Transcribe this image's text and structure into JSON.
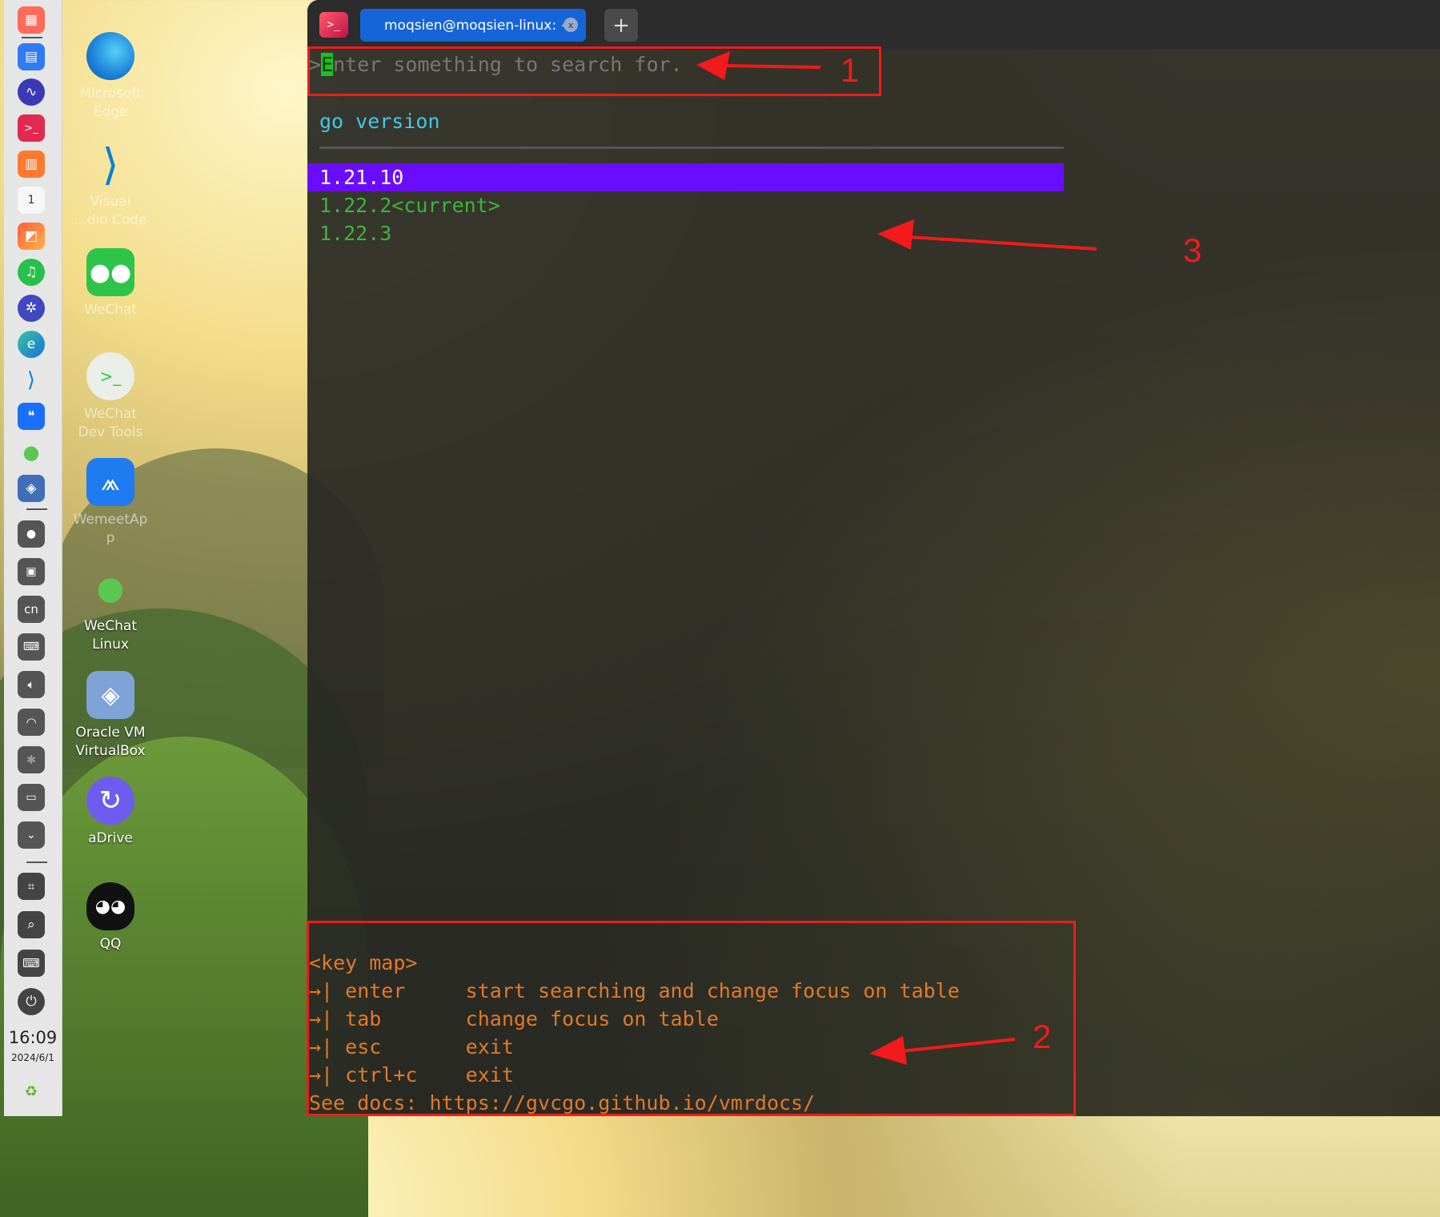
{
  "dock": {
    "time": "16:09",
    "date": "2024/6/1",
    "icons": [
      {
        "name": "launcher-icon",
        "color": "#ff6b5a"
      },
      {
        "name": "app-store-icon",
        "color": "#2f7bf3"
      },
      {
        "name": "system-monitor-icon",
        "color": "#3a39b8"
      },
      {
        "name": "terminal-icon",
        "color": "#e2294f"
      },
      {
        "name": "gift-box-icon",
        "color": "#ff7a2f"
      },
      {
        "name": "calendar-icon",
        "color": "#ffffff"
      },
      {
        "name": "photo-viewer-icon",
        "color": "#ff8a3a"
      },
      {
        "name": "music-icon",
        "color": "#27c04a"
      },
      {
        "name": "settings-icon",
        "color": "#3f48c0"
      },
      {
        "name": "edge-icon",
        "color": "#1d9bd6"
      },
      {
        "name": "vscode-icon",
        "color": "#0a7fd8"
      },
      {
        "name": "quote-app-icon",
        "color": "#1a6fff"
      },
      {
        "name": "wechat-icon",
        "color": "#5ac74f"
      },
      {
        "name": "virtualbox-icon",
        "color": "#3f6fb8"
      }
    ],
    "tray": [
      {
        "name": "wechat-tray-icon"
      },
      {
        "name": "screenshot-tray-icon"
      },
      {
        "name": "input-method-icon",
        "label": "cn"
      },
      {
        "name": "keyboard-tray-icon"
      },
      {
        "name": "volume-icon"
      },
      {
        "name": "wifi-icon"
      },
      {
        "name": "bluetooth-icon"
      },
      {
        "name": "display-icon"
      },
      {
        "name": "chevron-down-icon"
      },
      {
        "name": "crop-icon"
      },
      {
        "name": "search-icon"
      },
      {
        "name": "keyboard-icon"
      },
      {
        "name": "power-icon"
      },
      {
        "name": "trash-icon"
      }
    ]
  },
  "desktop": {
    "items": [
      {
        "label": "Microsoft\nEdge",
        "icon": "edge-icon",
        "faint": true
      },
      {
        "label": "Visual\n...dio Code",
        "icon": "vscode-icon",
        "faint": true
      },
      {
        "label": "WeChat",
        "icon": "wechat-icon",
        "faint": true
      },
      {
        "label": "WeChat\nDev Tools",
        "icon": "wechat-devtools-icon",
        "faint": true
      },
      {
        "label": "WemeetAp\np",
        "icon": "wemeet-icon",
        "faint": true
      },
      {
        "label": "WeChat\nLinux",
        "icon": "wechat-linux-icon",
        "faint": false
      },
      {
        "label": "Oracle VM\nVirtualBox",
        "icon": "virtualbox-icon",
        "faint": false
      },
      {
        "label": "aDrive",
        "icon": "adrive-icon",
        "faint": false
      },
      {
        "label": "QQ",
        "icon": "qq-icon",
        "faint": false
      }
    ]
  },
  "terminal": {
    "tab_title": "moqsien@moqsien-linux: ~",
    "tab_close": "x",
    "new_tab": "+",
    "prompt_symbol": ">",
    "cursor_char": "E",
    "search_placeholder_rest": "nter something to search for.",
    "heading": "go version",
    "versions": [
      "1.21.10",
      "1.22.2<current>",
      "1.22.3"
    ],
    "selected_index": 0,
    "keymap_title": "<key map>",
    "keymap": [
      {
        "key": "→| enter     ",
        "desc": "start searching and change focus on table"
      },
      {
        "key": "→| tab       ",
        "desc": "change focus on table"
      },
      {
        "key": "→| esc       ",
        "desc": "exit"
      },
      {
        "key": "→| ctrl+c    ",
        "desc": "exit"
      }
    ],
    "docs_line": "See docs: https://gvcgo.github.io/vmrdocs/"
  },
  "annotations": {
    "n1": "1",
    "n2": "2",
    "n3": "3",
    "color": "#f21a1a"
  }
}
